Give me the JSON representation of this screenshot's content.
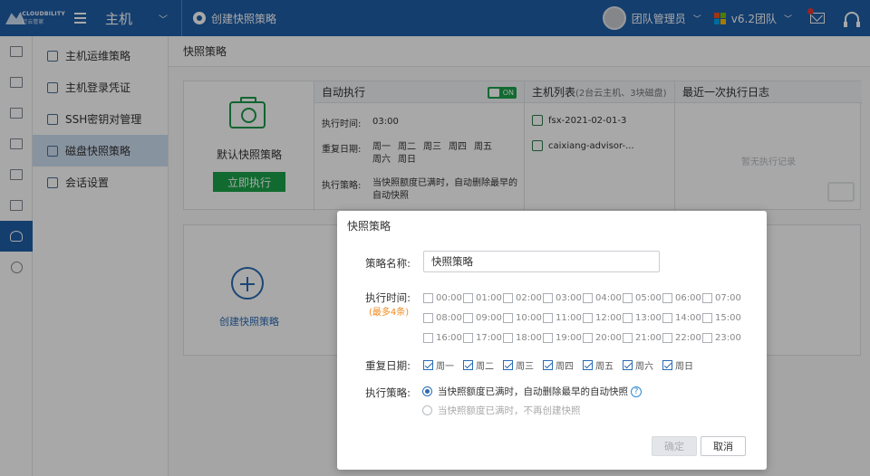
{
  "topbar": {
    "logo_en": "CLOUDBILITY",
    "logo_cn": "行云管家",
    "module": "主机",
    "breadcrumb": "创建快照策略",
    "user": "团队管理员",
    "team": "v6.2团队"
  },
  "submenu": [
    "主机运维策略",
    "主机登录凭证",
    "SSH密钥对管理",
    "磁盘快照策略",
    "会话设置"
  ],
  "page": {
    "title": "快照策略",
    "card": {
      "name": "默认快照策略",
      "run_button": "立即执行",
      "auto_exec_header": "自动执行",
      "toggle": "ON",
      "time_label": "执行时间:",
      "time_value": "03:00",
      "repeat_label": "重复日期:",
      "repeat_days": [
        "周一",
        "周二",
        "周三",
        "周四",
        "周五",
        "周六",
        "周日"
      ],
      "policy_label": "执行策略:",
      "policy_value": "当快照额度已满时，自动删除最早的自动快照",
      "host_header": "主机列表",
      "host_sub": "(2台云主机、3块磁盘)",
      "hosts": [
        "fsx-2021-02-01-3",
        "caixiang-advisor-..."
      ],
      "log_header": "最近一次执行日志",
      "log_empty": "暂无执行记录"
    },
    "create_label": "创建快照策略"
  },
  "modal": {
    "title": "快照策略",
    "name_label": "策略名称:",
    "name_value": "快照策略",
    "time_label": "执行时间:",
    "time_note": "(最多4条)",
    "times": [
      "00:00",
      "01:00",
      "02:00",
      "03:00",
      "04:00",
      "05:00",
      "06:00",
      "07:00",
      "08:00",
      "09:00",
      "10:00",
      "11:00",
      "12:00",
      "13:00",
      "14:00",
      "15:00",
      "16:00",
      "17:00",
      "18:00",
      "19:00",
      "20:00",
      "21:00",
      "22:00",
      "23:00"
    ],
    "repeat_label": "重复日期:",
    "days": [
      {
        "label": "周一",
        "checked": true
      },
      {
        "label": "周二",
        "checked": true
      },
      {
        "label": "周三",
        "checked": true
      },
      {
        "label": "周四",
        "checked": true
      },
      {
        "label": "周五",
        "checked": true
      },
      {
        "label": "周六",
        "checked": true
      },
      {
        "label": "周日",
        "checked": true
      }
    ],
    "policy_label": "执行策略:",
    "policy_option1": "当快照额度已满时，自动删除最早的自动快照",
    "policy_option2": "当快照额度已满时，不再创建快照",
    "help": "?",
    "ok": "确定",
    "cancel": "取消"
  }
}
